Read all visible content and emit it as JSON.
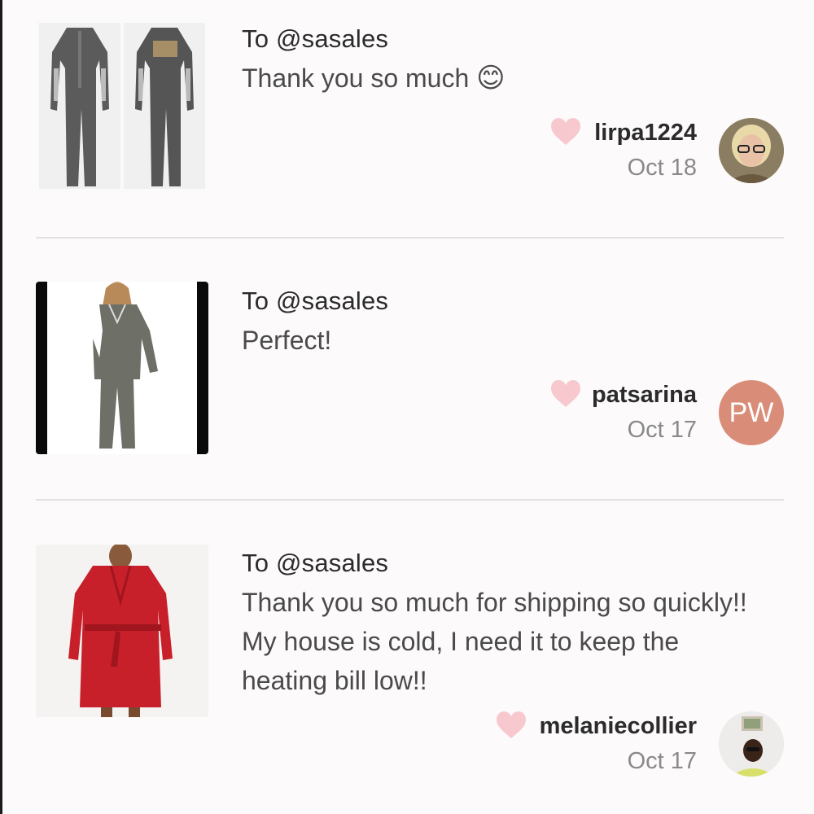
{
  "reviews": [
    {
      "title": "To @sasales",
      "message": "Thank you so much",
      "emoji": "😊",
      "username": "lirpa1224",
      "date": "Oct 18",
      "thumbnail": "gray-onesie-pajamas-image",
      "avatar": "user-photo-avatar"
    },
    {
      "title": "To @sasales",
      "message": "Perfect!",
      "username": "patsarina",
      "date": "Oct 17",
      "thumbnail": "gray-pajama-set-image",
      "avatar_initials": "PW"
    },
    {
      "title": "To @sasales",
      "message": "Thank you so much for shipping so quickly!! My house is cold, I need it to keep the heating bill low!!",
      "username": "melaniecollier",
      "date": "Oct 17",
      "thumbnail": "red-robe-image",
      "avatar": "user-photo-avatar"
    }
  ],
  "colors": {
    "background": "#fcfafa",
    "heart": "#f7c9cf",
    "initials_avatar": "#d98d78",
    "divider": "#e2e0e0",
    "robe": "#c8202a"
  }
}
